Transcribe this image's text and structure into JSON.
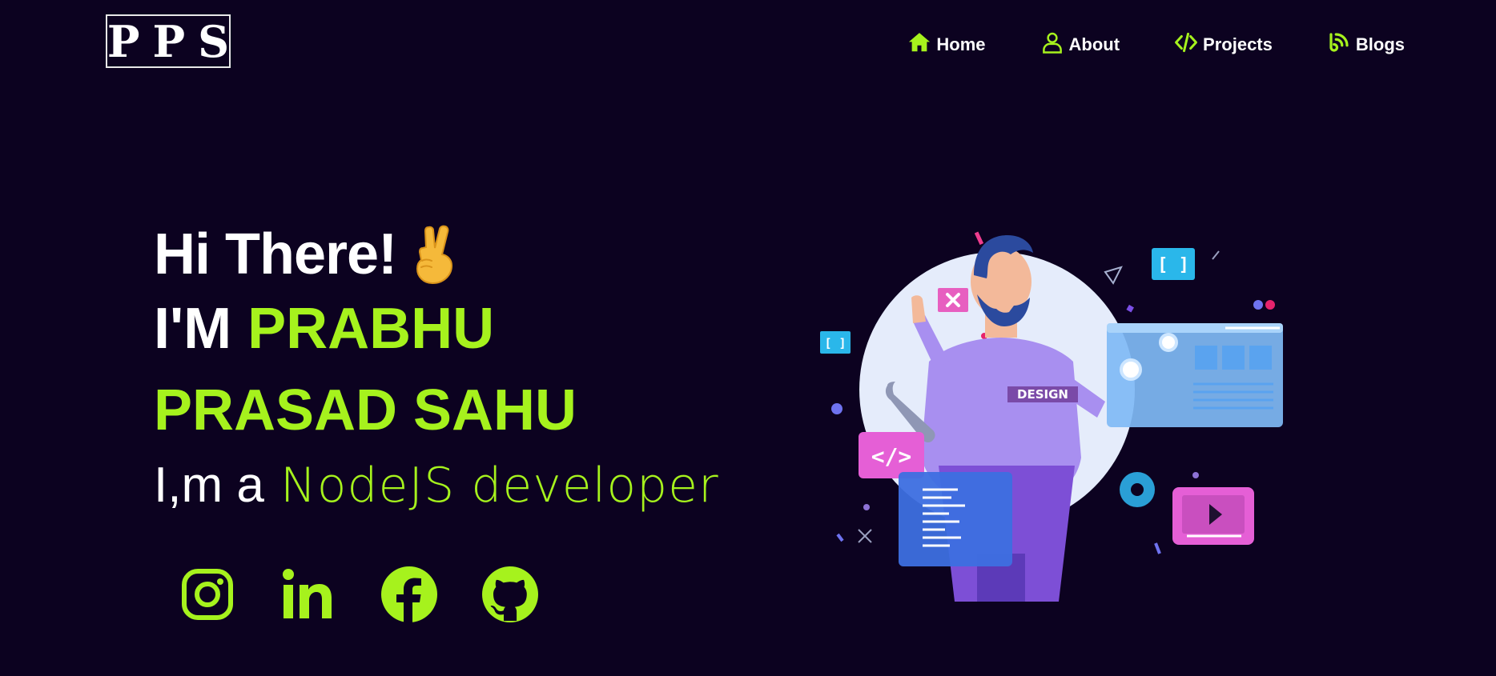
{
  "brand": {
    "logo_text": "PPS"
  },
  "nav": {
    "items": [
      {
        "label": "Home",
        "icon": "home-icon"
      },
      {
        "label": "About",
        "icon": "user-icon"
      },
      {
        "label": "Projects",
        "icon": "code-icon"
      },
      {
        "label": "Blogs",
        "icon": "rss-icon"
      }
    ]
  },
  "hero": {
    "greeting": "Hi There!",
    "greeting_emoji": "victory-hand-icon",
    "name_prefix": "I'M",
    "name_first": "PRABHU",
    "name_rest": "PRASAD SAHU",
    "role_prefix": "I,m a",
    "role_value": "NodeJS developer"
  },
  "social": {
    "links": [
      {
        "icon": "instagram-icon"
      },
      {
        "icon": "linkedin-icon"
      },
      {
        "icon": "facebook-icon"
      },
      {
        "icon": "github-icon"
      }
    ]
  },
  "illustration": {
    "badge_text": "DESIGN"
  },
  "colors": {
    "background": "#0c0220",
    "accent": "#a6f21d",
    "text": "#ffffff"
  }
}
